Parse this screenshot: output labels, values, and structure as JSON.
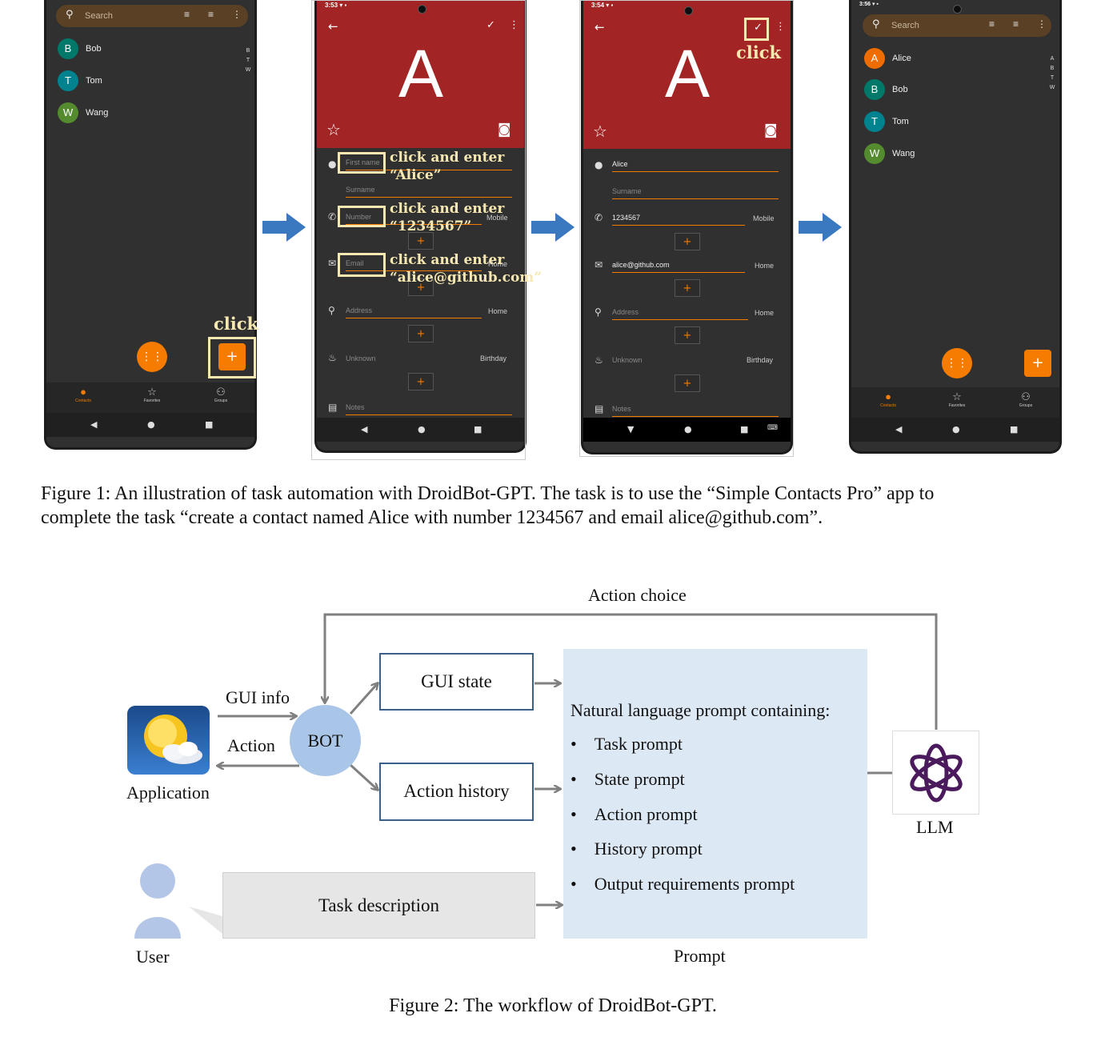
{
  "figure1": {
    "caption_line1": "Figure 1: An illustration of task automation with DroidBot-GPT. The task is to use the “Simple Contacts Pro” app to",
    "caption_line2": "complete the task “create a contact named Alice with number 1234567 and email alice@github.com”.",
    "phone1": {
      "search_placeholder": "Search",
      "contacts": [
        {
          "initial": "B",
          "name": "Bob",
          "color": "#00796b"
        },
        {
          "initial": "T",
          "name": "Tom",
          "color": "#00838f"
        },
        {
          "initial": "W",
          "name": "Wang",
          "color": "#558b2f"
        }
      ],
      "index_letters": [
        "B",
        "T",
        "W"
      ],
      "click_label": "click",
      "fab_dialpad": "⋮⋮",
      "fab_add": "+",
      "nav": [
        {
          "icon": "person-icon",
          "label": "Contacts"
        },
        {
          "icon": "star-icon",
          "label": "Favorites"
        },
        {
          "icon": "groups-icon",
          "label": "Groups"
        }
      ]
    },
    "phone2": {
      "status_time": "3:53",
      "avatar_letter": "A",
      "fields": {
        "first_name": "First name",
        "surname": "Surname",
        "number": "Number",
        "number_type": "Mobile",
        "email": "Email",
        "email_type": "Home",
        "address": "Address",
        "address_type": "Home",
        "event": "Unknown",
        "event_type": "Birthday",
        "notes": "Notes"
      },
      "annotations": [
        {
          "line1": "click and enter",
          "line2": "“Alice”"
        },
        {
          "line1": "click and enter",
          "line2": "“1234567”"
        },
        {
          "line1": "click and enter",
          "line2": "“alice@github.com”"
        }
      ]
    },
    "phone3": {
      "status_time": "3:54",
      "avatar_letter": "A",
      "click_label": "click",
      "fields": {
        "first_name": "Alice",
        "surname": "Surname",
        "number": "1234567",
        "number_type": "Mobile",
        "email": "alice@github.com",
        "email_type": "Home",
        "address": "Address",
        "address_type": "Home",
        "event": "Unknown",
        "event_type": "Birthday",
        "notes": "Notes"
      }
    },
    "phone4": {
      "status_time": "3:56",
      "search_placeholder": "Search",
      "contacts": [
        {
          "initial": "A",
          "name": "Alice",
          "color": "#ef6c00"
        },
        {
          "initial": "B",
          "name": "Bob",
          "color": "#00796b"
        },
        {
          "initial": "T",
          "name": "Tom",
          "color": "#00838f"
        },
        {
          "initial": "W",
          "name": "Wang",
          "color": "#558b2f"
        }
      ],
      "index_letters": [
        "A",
        "B",
        "T",
        "W"
      ],
      "nav": [
        {
          "icon": "person-icon",
          "label": "Contacts"
        },
        {
          "icon": "star-icon",
          "label": "Favorites"
        },
        {
          "icon": "groups-icon",
          "label": "Groups"
        }
      ]
    }
  },
  "figure2": {
    "caption": "Figure 2: The workflow of DroidBot-GPT.",
    "action_choice": "Action choice",
    "gui_info": "GUI info",
    "action": "Action",
    "application": "Application",
    "bot": "BOT",
    "gui_state": "GUI state",
    "action_history": "Action history",
    "prompt_heading": "Natural language prompt containing:",
    "prompt_items": [
      "Task prompt",
      "State prompt",
      "Action prompt",
      "History prompt",
      "Output requirements prompt"
    ],
    "prompt_label": "Prompt",
    "llm": "LLM",
    "task_description": "Task description",
    "user": "User",
    "colors": {
      "bot_fill": "#a9c6e8",
      "prompt_fill": "#dde8f5",
      "box_border": "#3a5f8a",
      "task_fill": "#e6e6e6",
      "llm_logo": "#4a1a5c",
      "arrow_blue": "#3a78c0"
    }
  }
}
